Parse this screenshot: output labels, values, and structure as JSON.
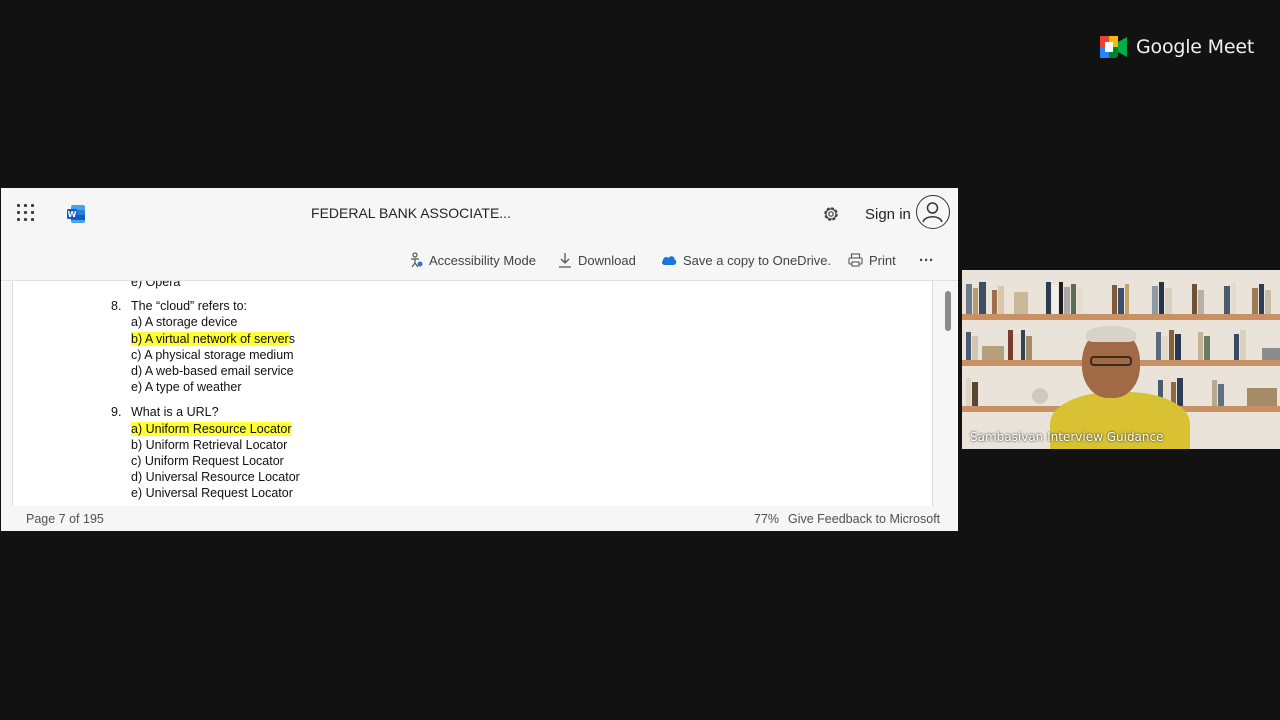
{
  "meet": {
    "brand": "Google Meet"
  },
  "word": {
    "title": "FEDERAL BANK ASSOCIATE...",
    "signin": "Sign in",
    "toolbar": {
      "accessibility": "Accessibility Mode",
      "download": "Download",
      "onedrive": "Save a copy to OneDrive.",
      "print": "Print",
      "more": "···"
    },
    "doc": {
      "prev_tail": "e) Opera",
      "q8": {
        "number": "8.",
        "question": "The “cloud” refers to:",
        "options": [
          "a) A storage device",
          "b) A virtual network of server",
          "c) A physical storage medium",
          "d) A web-based email service",
          "e) A type of weather"
        ],
        "highlight_tail": "s"
      },
      "q9": {
        "number": "9.",
        "question": "What is a URL?",
        "options": [
          "a) Uniform Resource Locator",
          "b) Uniform Retrieval Locator",
          "c) Uniform Request Locator",
          "d) Universal Resource Locator",
          "e) Universal Request Locator"
        ]
      }
    },
    "status": {
      "page": "Page 7 of 195",
      "zoom": "77%",
      "feedback": "Give Feedback to Microsoft"
    }
  },
  "participant": {
    "name": "Sambasivan Interview Guidance"
  },
  "colors": {
    "highlight": "#ffff33",
    "meet_bg": "#121212",
    "word_blue": "#185abd"
  }
}
